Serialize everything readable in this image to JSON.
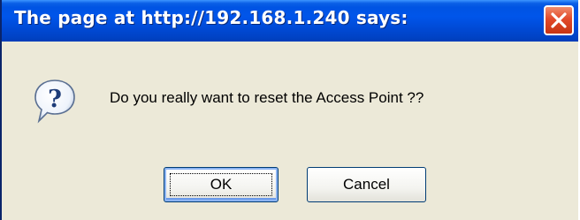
{
  "dialog": {
    "title": "The page at http://192.168.1.240 says:",
    "message": "Do you really want to reset the Access Point ??",
    "icon": "question-icon",
    "buttons": {
      "ok_label": "OK",
      "cancel_label": "Cancel"
    }
  },
  "colors": {
    "titlebar": "#0054E3",
    "close_button": "#E2492A",
    "dialog_background": "#ECE9D8"
  }
}
